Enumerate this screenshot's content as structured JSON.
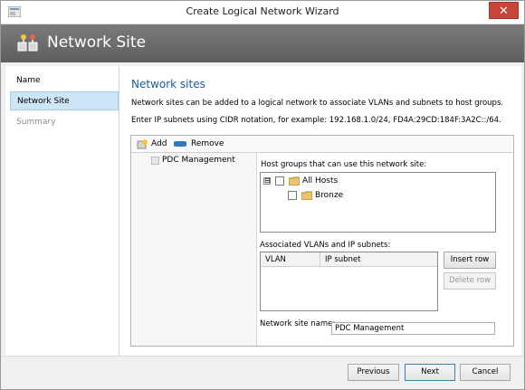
{
  "window": {
    "title": "Create Logical Network Wizard",
    "close_glyph": "✕"
  },
  "header": {
    "title": "Network Site",
    "icon": "network-site-icon"
  },
  "sidebar": {
    "items": [
      {
        "label": "Name",
        "state": "normal"
      },
      {
        "label": "Network Site",
        "state": "active"
      },
      {
        "label": "Summary",
        "state": "disabled"
      }
    ]
  },
  "main": {
    "section_title": "Network sites",
    "description_1": "Network sites can be added to a logical network to associate VLANs and subnets to host groups.",
    "description_2": "Enter IP subnets using CIDR notation, for example: 192.168.1.0/24, FD4A:29CD:184F:3A2C::/64."
  },
  "toolbar": {
    "add_label": "Add",
    "remove_label": "Remove"
  },
  "sites": {
    "items": [
      "PDC Management"
    ]
  },
  "host_groups": {
    "label": "Host groups that can use this network site:",
    "tree": [
      {
        "label": "All Hosts",
        "expander": "⊟"
      },
      {
        "label": "Bronze"
      }
    ]
  },
  "vlans": {
    "label": "Associated VLANs and IP subnets:",
    "columns": [
      "VLAN",
      "IP subnet"
    ],
    "insert_row_label": "Insert row",
    "delete_row_label": "Delete row"
  },
  "site_name": {
    "label": "Network site name:",
    "value": "PDC Management"
  },
  "footer": {
    "previous_label": "Previous",
    "next_label": "Next",
    "cancel_label": "Cancel"
  },
  "colors": {
    "section_title": "#1a5a9c",
    "active_nav_bg": "#cde6f7",
    "header_bg": "#6a6a6a",
    "close_button": "#c7443a"
  }
}
